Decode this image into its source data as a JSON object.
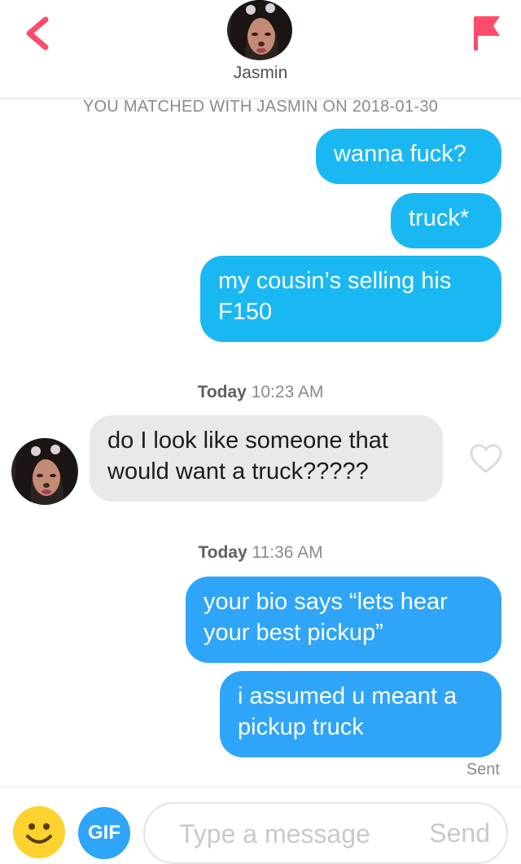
{
  "header": {
    "name": "Jasmin",
    "back_icon": "chevron-left-icon",
    "report_icon": "flag-icon",
    "accent_color": "#fe4a6b"
  },
  "match_banner": "YOU MATCHED WITH JASMIN ON 2018-01-30",
  "messages": {
    "m1": "wanna fuck?",
    "m2": "truck*",
    "m3_line1": "my cousin’s selling his",
    "m3_line2": "F150",
    "ts1_day": "Today",
    "ts1_time": "10:23 AM",
    "r1_line1": "do I look like someone that",
    "r1_line2": "would want a truck?????",
    "ts2_day": "Today",
    "ts2_time": "11:36 AM",
    "m4_line1": "your bio says “lets hear",
    "m4_line2": "your best pickup”",
    "m5_line1": "i assumed u meant a",
    "m5_line2": "pickup truck",
    "status": "Sent"
  },
  "composer": {
    "gif_label": "GIF",
    "placeholder": "Type a message",
    "send_label": "Send",
    "emoji_icon": "smiley-icon"
  }
}
